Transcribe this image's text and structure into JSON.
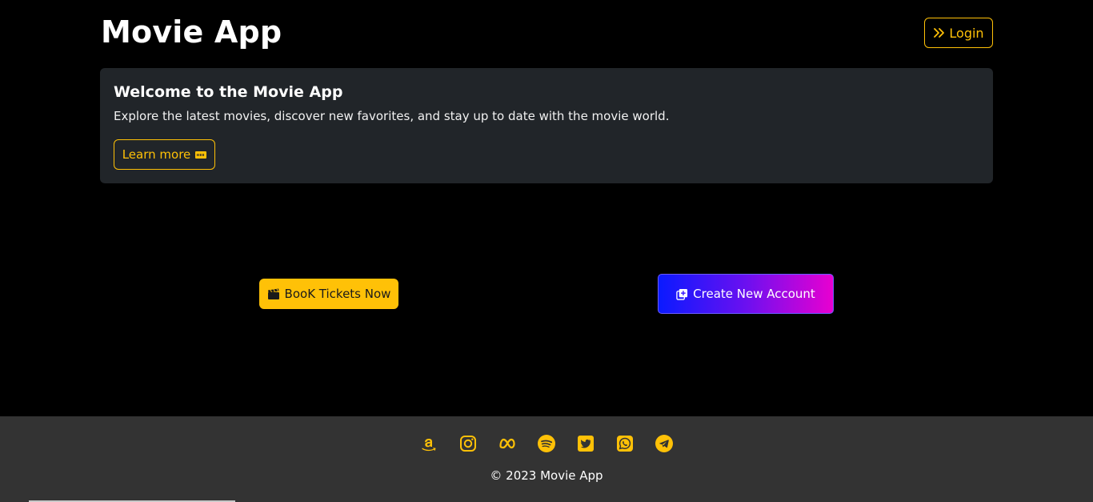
{
  "header": {
    "title": "Movie App",
    "login_label": "Login"
  },
  "welcome": {
    "title": "Welcome to the Movie App",
    "text": "Explore the latest movies, discover new favorites, and stay up to date with the movie world.",
    "learn_more_label": "Learn more"
  },
  "actions": {
    "book_label": "BooK Tickets Now",
    "create_label": "Create New Account"
  },
  "footer": {
    "social_icons": [
      "amazon-icon",
      "instagram-icon",
      "meta-icon",
      "spotify-icon",
      "twitter-icon",
      "whatsapp-icon",
      "telegram-icon"
    ],
    "copyright": "© 2023 Movie App"
  },
  "colors": {
    "accent": "#ffc107",
    "background": "#000000",
    "card": "#212529",
    "footer": "#333333",
    "gradient_start": "#0a1aff",
    "gradient_end": "#e800d0"
  }
}
